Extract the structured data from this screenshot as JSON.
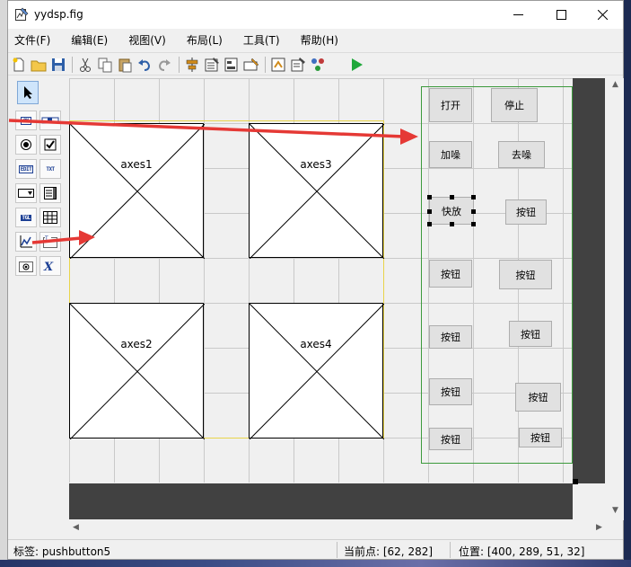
{
  "window": {
    "title": "yydsp.fig",
    "icon": "figure-file-icon"
  },
  "menu": [
    {
      "label": "文件(F)"
    },
    {
      "label": "编辑(E)"
    },
    {
      "label": "视图(V)"
    },
    {
      "label": "布局(L)"
    },
    {
      "label": "工具(T)"
    },
    {
      "label": "帮助(H)"
    }
  ],
  "toolbar": [
    "new-file-icon",
    "open-folder-icon",
    "save-icon",
    "cut-icon",
    "copy-icon",
    "paste-icon",
    "undo-icon",
    "redo-icon",
    "align-icon",
    "menu-editor-icon",
    "tab-order-icon",
    "toolbar-editor-icon",
    "mfile-editor-icon",
    "property-inspector-icon",
    "object-browser-icon",
    "run-icon"
  ],
  "palette": {
    "push_label": "OK",
    "slider_label": "slider",
    "edit_label": "EDIT",
    "text_label": "TXT",
    "toggle_label": "TGL"
  },
  "axes": [
    {
      "label": "axes1"
    },
    {
      "label": "axes3"
    },
    {
      "label": "axes2"
    },
    {
      "label": "axes4"
    }
  ],
  "buttons": {
    "open": "打开",
    "stop": "停止",
    "add_noise": "加噪",
    "denoise": "去噪",
    "fast_play": "快放",
    "generic": "按钮"
  },
  "status": {
    "tag": "标签: pushbutton5",
    "current_point": "当前点:  [62, 282]",
    "position": "位置: [400, 289, 51, 32]"
  },
  "colors": {
    "annotation_arrow": "#e53935",
    "panel_border": "#3c9a3c",
    "figure_outline": "#e8d44a",
    "run_green": "#1fa83a"
  }
}
